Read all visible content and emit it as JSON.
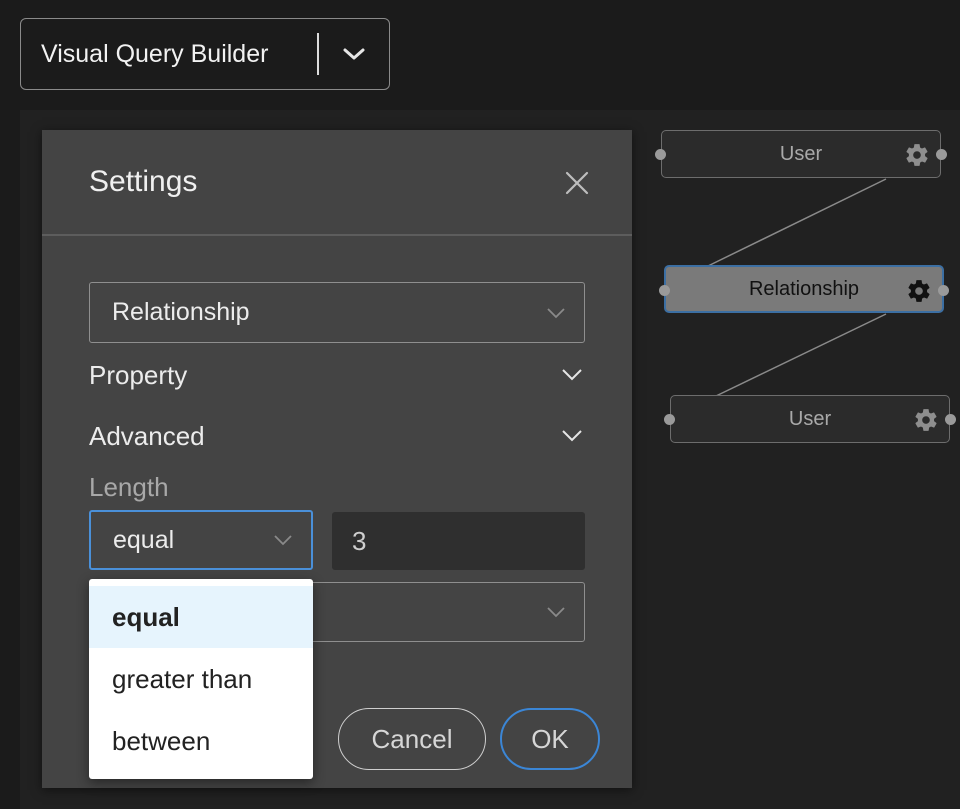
{
  "header": {
    "mode_label": "Visual Query Builder"
  },
  "graph": {
    "nodes": [
      {
        "label": "User",
        "active": false
      },
      {
        "label": "Relationship",
        "active": true
      },
      {
        "label": "User",
        "active": false
      }
    ]
  },
  "dialog": {
    "title": "Settings",
    "type_select_value": "Relationship",
    "sections": [
      {
        "label": "Property"
      },
      {
        "label": "Advanced"
      }
    ],
    "length": {
      "label": "Length",
      "operator_value": "equal",
      "value": "3"
    },
    "buttons": {
      "cancel": "Cancel",
      "ok": "OK"
    }
  },
  "operator_menu": {
    "options": [
      "equal",
      "greater than",
      "between"
    ],
    "selected_index": 0
  },
  "colors": {
    "accent": "#4a90d9",
    "dialog_bg": "#444444",
    "canvas_bg": "#212121",
    "menu_selected_bg": "#e6f4fd"
  }
}
